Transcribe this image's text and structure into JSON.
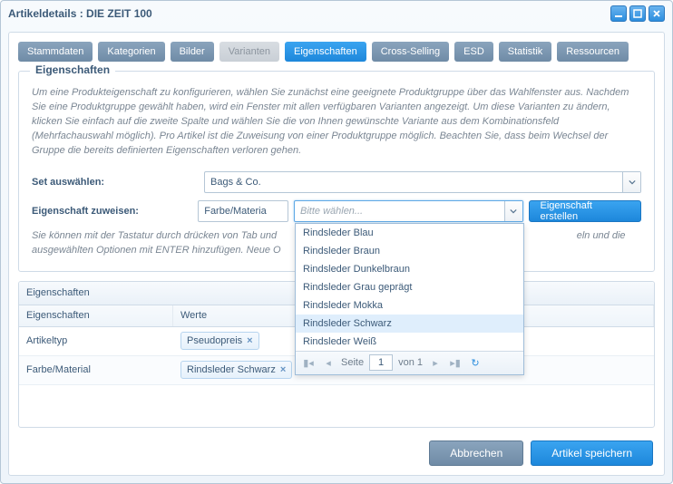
{
  "window": {
    "title": "Artikeldetails : DIE ZEIT 100"
  },
  "tabs": [
    {
      "label": "Stammdaten",
      "state": "normal"
    },
    {
      "label": "Kategorien",
      "state": "normal"
    },
    {
      "label": "Bilder",
      "state": "normal"
    },
    {
      "label": "Varianten",
      "state": "disabled"
    },
    {
      "label": "Eigenschaften",
      "state": "active"
    },
    {
      "label": "Cross-Selling",
      "state": "normal"
    },
    {
      "label": "ESD",
      "state": "normal"
    },
    {
      "label": "Statistik",
      "state": "normal"
    },
    {
      "label": "Ressourcen",
      "state": "normal"
    }
  ],
  "panel": {
    "legend": "Eigenschaften",
    "help1": "Um eine Produkteigenschaft zu konfigurieren, wählen Sie zunächst eine geeignete Produktgruppe über das Wahlfenster aus. Nachdem Sie eine Produktgruppe gewählt haben, wird ein Fenster mit allen verfügbaren Varianten angezeigt. Um diese Varianten zu ändern, klicken Sie einfach auf die zweite Spalte und wählen Sie die von Ihnen gewünschte Variante aus dem Kombinationsfeld (Mehrfachauswahl möglich). Pro Artikel ist die Zuweisung von einer Produktgruppe möglich. Beachten Sie, dass beim Wechsel der Gruppe die bereits definierten Eigenschaften verloren gehen.",
    "set_label": "Set auswählen:",
    "set_value": "Bags & Co.",
    "assign_label": "Eigenschaft zuweisen:",
    "assign_prop_value": "Farbe/Materia",
    "assign_value_placeholder": "Bitte wählen...",
    "create_btn": "Eigenschaft erstellen",
    "help2_a": "Sie können mit der Tastatur durch drücken von Tab und",
    "help2_b": "eln und die ausgewählten Optionen mit ENTER hinzufügen. Neue O"
  },
  "grid": {
    "title": "Eigenschaften",
    "cols": [
      "Eigenschaften",
      "Werte"
    ],
    "rows": [
      {
        "prop": "Artikeltyp",
        "tags": [
          "Pseudopreis"
        ]
      },
      {
        "prop": "Farbe/Material",
        "tags": [
          "Rindsleder Schwarz"
        ]
      }
    ]
  },
  "dropdown": {
    "items": [
      {
        "label": "Rindsleder Blau",
        "selected": false
      },
      {
        "label": "Rindsleder Braun",
        "selected": false
      },
      {
        "label": "Rindsleder Dunkelbraun",
        "selected": false
      },
      {
        "label": "Rindsleder Grau geprägt",
        "selected": false
      },
      {
        "label": "Rindsleder Mokka",
        "selected": false
      },
      {
        "label": "Rindsleder Schwarz",
        "selected": true
      },
      {
        "label": "Rindsleder Weiß",
        "selected": false
      }
    ],
    "page_label": "Seite",
    "page_value": "1",
    "page_of": "von 1"
  },
  "footer": {
    "cancel": "Abbrechen",
    "save": "Artikel speichern"
  }
}
